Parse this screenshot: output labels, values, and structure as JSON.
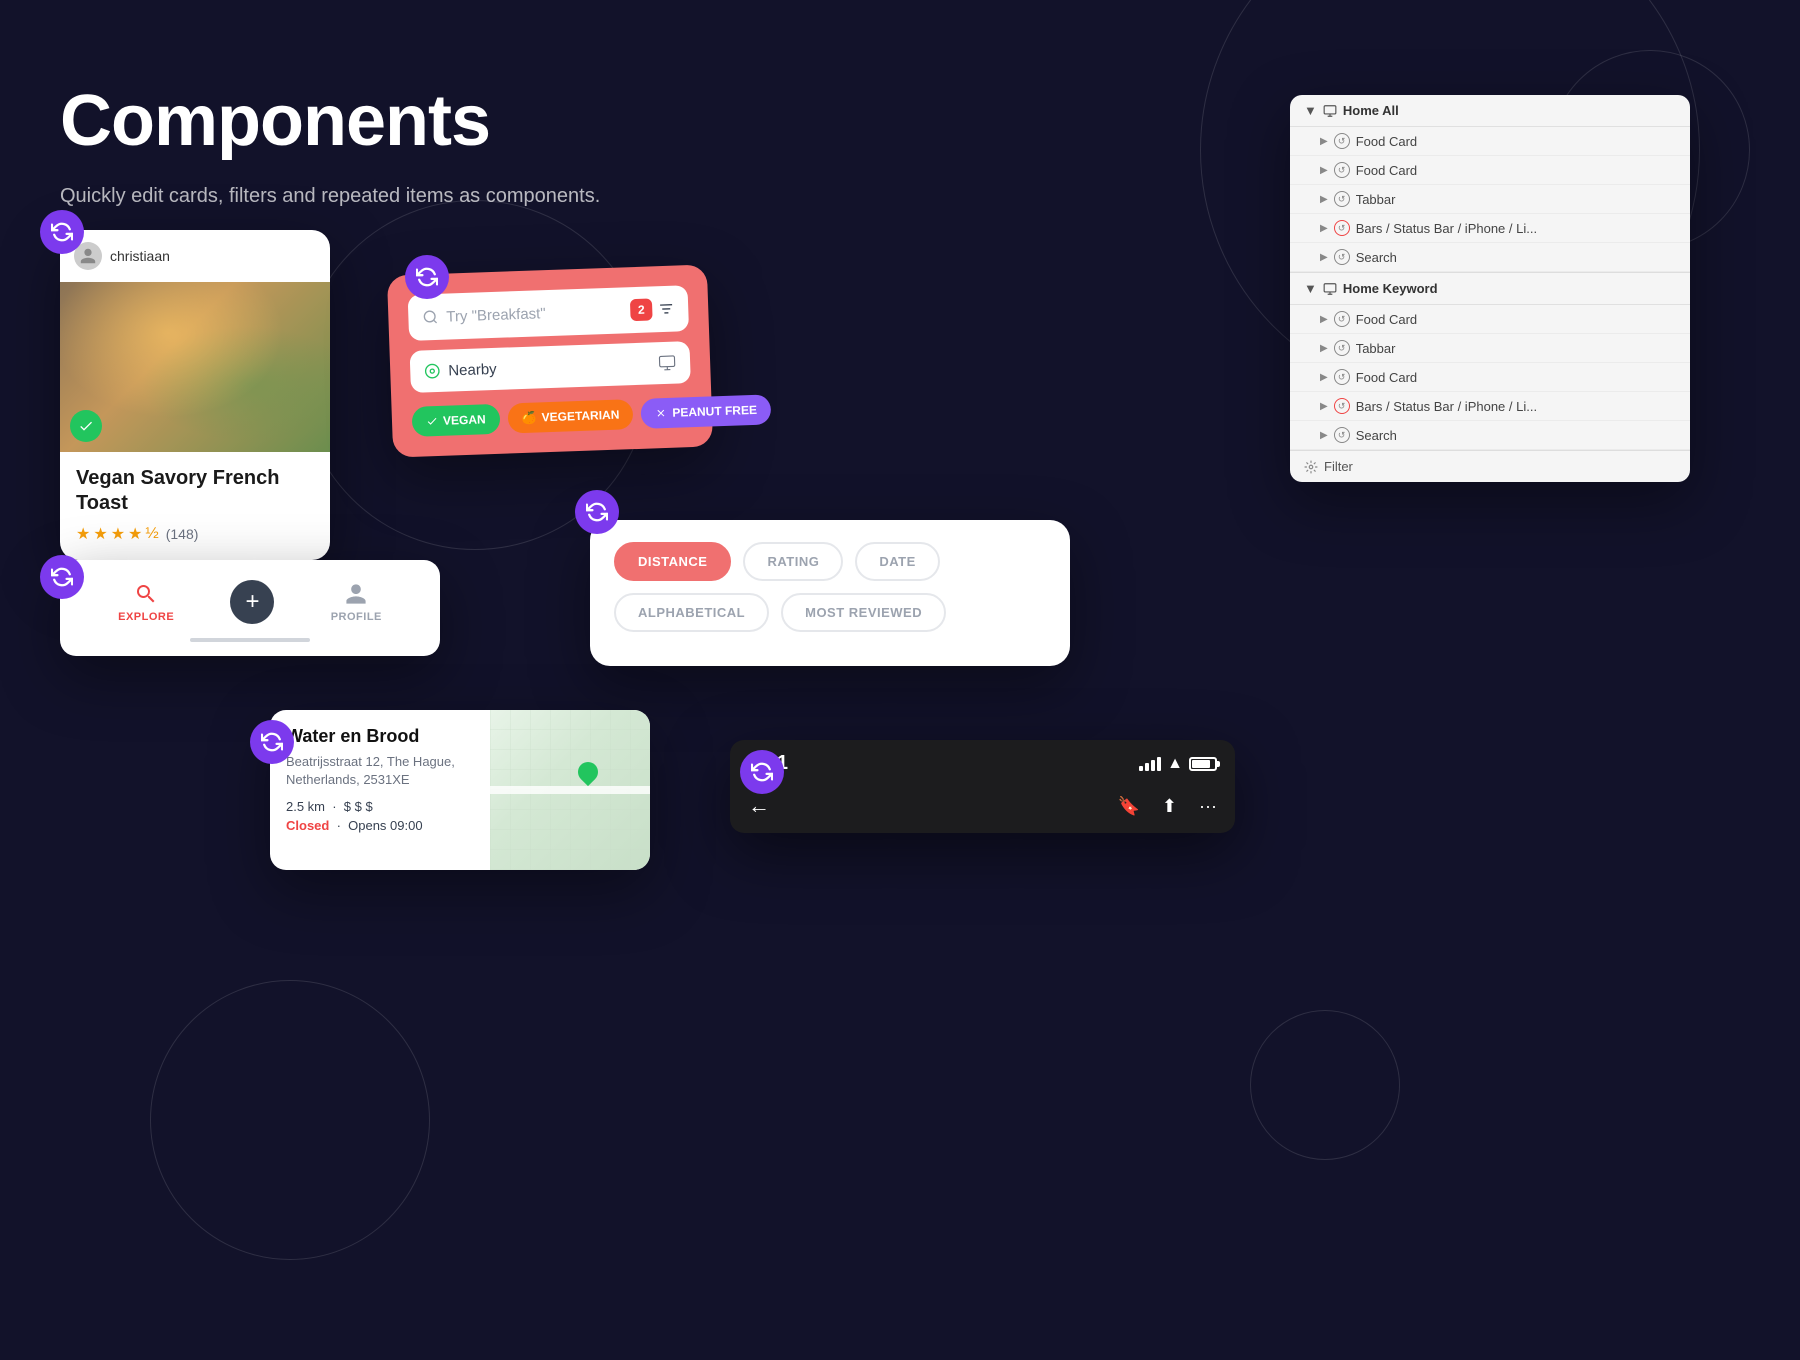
{
  "page": {
    "title": "Components",
    "subtitle": "Quickly edit cards, filters and repeated items as components.",
    "background": "#12122a"
  },
  "foodCard": {
    "username": "christiaan",
    "title": "Vegan Savory French Toast",
    "rating": 4.5,
    "reviewCount": "(148)",
    "stars": [
      "filled",
      "filled",
      "filled",
      "filled",
      "half"
    ]
  },
  "searchCard": {
    "placeholder": "Try \"Breakfast\"",
    "nearbyLabel": "Nearby",
    "badgeCount": "2",
    "chips": [
      {
        "label": "VEGAN",
        "type": "vegan"
      },
      {
        "label": "VEGETARIAN",
        "type": "veg"
      },
      {
        "label": "PEANUT FREE",
        "type": "peanut"
      }
    ]
  },
  "navigator": {
    "sections": [
      {
        "name": "Home All",
        "items": [
          {
            "label": "Food Card"
          },
          {
            "label": "Food Card"
          },
          {
            "label": "Tabbar"
          },
          {
            "label": "Bars / Status Bar / iPhone / Li..."
          },
          {
            "label": "Search"
          }
        ]
      },
      {
        "name": "Home Keyword",
        "items": [
          {
            "label": "Food Card"
          },
          {
            "label": "Tabbar"
          },
          {
            "label": "Food Card"
          },
          {
            "label": "Bars / Status Bar / iPhone / Li..."
          },
          {
            "label": "Search"
          }
        ]
      }
    ],
    "filterLabel": "Filter"
  },
  "tabbar": {
    "items": [
      {
        "label": "EXPLORE",
        "active": true
      },
      {
        "label": "+",
        "type": "add"
      },
      {
        "label": "PROFILE",
        "active": false
      }
    ]
  },
  "sortFilter": {
    "options": [
      {
        "label": "DISTANCE",
        "active": true
      },
      {
        "label": "RATING",
        "active": false
      },
      {
        "label": "DATE",
        "active": false
      },
      {
        "label": "ALPHABETICAL",
        "active": false
      },
      {
        "label": "MOST REVIEWED",
        "active": false
      }
    ]
  },
  "mapCard": {
    "name": "Water en Brood",
    "address": "Beatrijsstraat 12, The Hague, Netherlands, 2531XE",
    "distance": "2.5 km",
    "priceRange": "$ $ $",
    "status": "Closed",
    "opensAt": "Opens 09:00"
  },
  "statusBar": {
    "time": "9:41",
    "backLabel": "←",
    "actions": [
      "bookmark",
      "share",
      "more"
    ]
  }
}
